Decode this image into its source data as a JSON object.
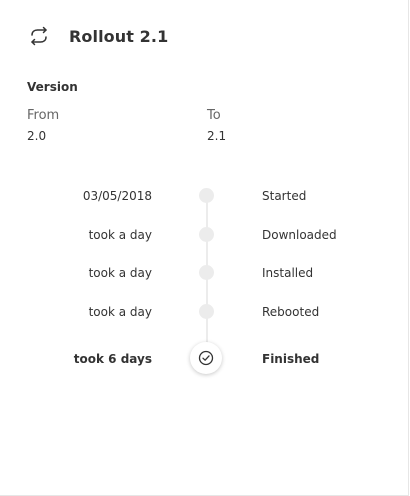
{
  "header": {
    "icon": "rollout-cycle-icon",
    "title": "Rollout 2.1"
  },
  "version": {
    "section_label": "Version",
    "from_label": "From",
    "from_value": "2.0",
    "to_label": "To",
    "to_value": "2.1"
  },
  "timeline": {
    "steps": [
      {
        "when": "03/05/2018",
        "label": "Started",
        "status": "done"
      },
      {
        "when": "took a day",
        "label": "Downloaded",
        "status": "done"
      },
      {
        "when": "took a day",
        "label": "Installed",
        "status": "done"
      },
      {
        "when": "took a day",
        "label": "Rebooted",
        "status": "done"
      },
      {
        "when": "took 6 days",
        "label": "Finished",
        "status": "complete"
      }
    ]
  },
  "colors": {
    "text": "#333333",
    "muted": "#666666",
    "track": "#ececec"
  }
}
